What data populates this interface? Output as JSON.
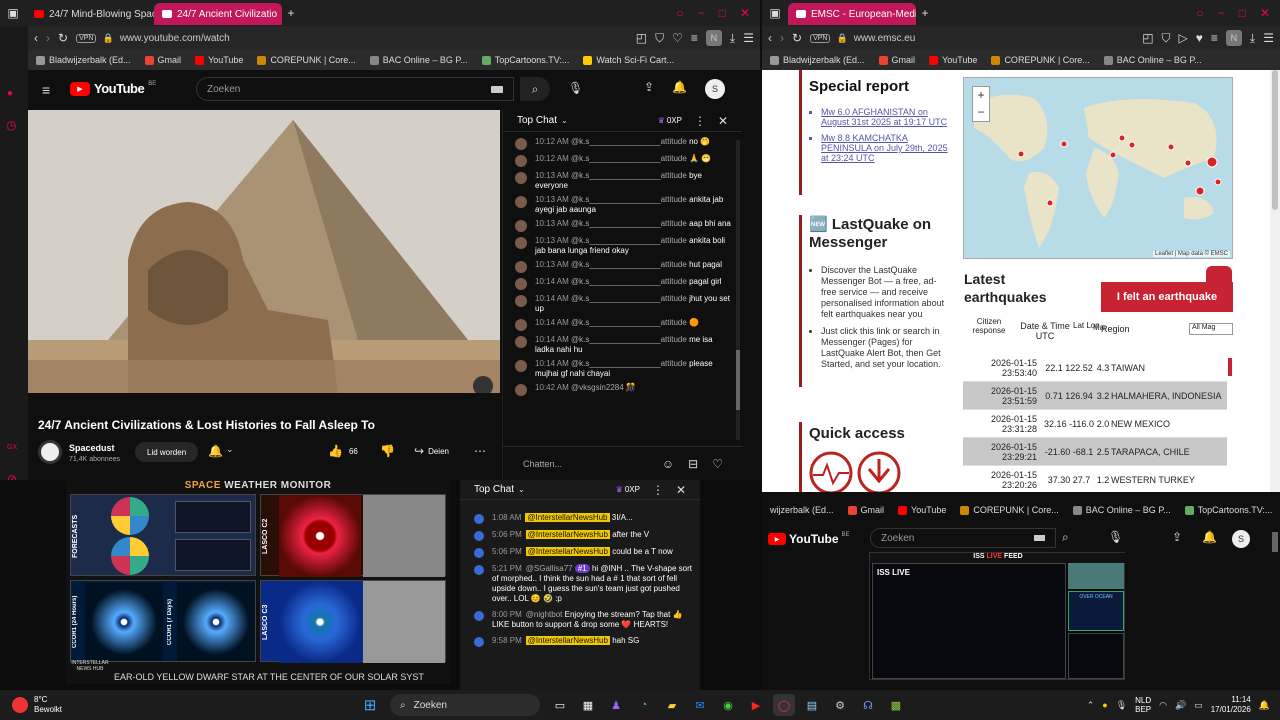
{
  "left_browser": {
    "tabs": [
      {
        "label": "24/7 Mind-Blowing Space"
      },
      {
        "label": "24/7 Ancient Civilizatio"
      }
    ],
    "url": "www.youtube.com/watch",
    "vpn": "VPN",
    "bookmarks": [
      "Bladwijzerbalk (Ed...",
      "Gmail",
      "YouTube",
      "COREPUNK | Core...",
      "BAC Online – BG P...",
      "TopCartoons.TV:...",
      "Watch Sci-Fi Cart..."
    ],
    "profile_letter": "N"
  },
  "youtube": {
    "logo": "YouTube",
    "region": "BE",
    "search_placeholder": "Zoeken",
    "avatar_letter": "S",
    "video_title": "24/7 Ancient Civilizations & Lost Histories to Fall Asleep To",
    "channel": "Spacedust",
    "subscribers": "71,4K abonnees",
    "join": "Lid worden",
    "likes": "66",
    "share": "Deien",
    "chat": {
      "title": "Top Chat",
      "points": "0XP",
      "input_placeholder": "Chatten...",
      "messages": [
        {
          "time": "10:12 AM",
          "name": "@k.s________________attitude",
          "text": "no 🤭"
        },
        {
          "time": "10:12 AM",
          "name": "@k.s________________attitude",
          "text": "🙏 😁"
        },
        {
          "time": "10:13 AM",
          "name": "@k.s________________attitude",
          "text": "bye everyone"
        },
        {
          "time": "10:13 AM",
          "name": "@k.s________________attitude",
          "text": "ankita jab ayegi jab aaunga"
        },
        {
          "time": "10:13 AM",
          "name": "@k.s________________attitude",
          "text": "aap bhi ana"
        },
        {
          "time": "10:13 AM",
          "name": "@k.s________________attitude",
          "text": "ankita boli jab bana lunga friend okay"
        },
        {
          "time": "10:13 AM",
          "name": "@k.s________________attitude",
          "text": "hut pagal"
        },
        {
          "time": "10:14 AM",
          "name": "@k.s________________attitude",
          "text": "pagal girl"
        },
        {
          "time": "10:14 AM",
          "name": "@k.s________________attitude",
          "text": "jhut you set up"
        },
        {
          "time": "10:14 AM",
          "name": "@k.s________________attitude",
          "text": "🟠"
        },
        {
          "time": "10:14 AM",
          "name": "@k.s________________attitude",
          "text": "me isa ladka nahi hu"
        },
        {
          "time": "10:14 AM",
          "name": "@k.s________________attitude",
          "text": "please mujhai gf nahi chayai"
        },
        {
          "time": "10:42 AM",
          "name": "@vksgsin2284",
          "text": "🎊"
        }
      ]
    }
  },
  "space_weather": {
    "title_a": "SPACE",
    "title_b": "WEATHER MONITOR",
    "panel_labels": [
      "FORECASTS",
      "LASCO C2",
      "CCOR1 (24 Hours)",
      "CCOR1 (7 Days)",
      "LASCO C3"
    ],
    "ticker": "EAR-OLD YELLOW DWARF STAR AT THE CENTER OF OUR SOLAR SYST",
    "brand": "INTERSTELLAR NEWS HUB"
  },
  "bottom_chat": {
    "title": "Top Chat",
    "points": "0XP",
    "messages": [
      {
        "time": "1:08 AM",
        "name": "@InterstellarNewsHub",
        "text": "3I/A..."
      },
      {
        "time": "5:06 PM",
        "name": "@InterstellarNewsHub",
        "text": "after the V"
      },
      {
        "time": "5:06 PM",
        "name": "@InterstellarNewsHub",
        "text": "could be a T now"
      },
      {
        "time": "5:21 PM",
        "name": "@SGallisa77",
        "badge": "#1",
        "text": "hi @INH .. The V-shape sort of morphed.. I think the sun had a # 1 that sort of fell upside down.. I guess the sun's team just got pushed over.. LOL 😊 🤣 :p"
      },
      {
        "time": "8:00 PM",
        "name": "@nightbot",
        "text": "Enjoying the stream? Tap that 👍 LIKE button to support & drop some ❤️ HEARTS!"
      },
      {
        "time": "9:58 PM",
        "name": "@InterstellarNewsHub",
        "text": "hah SG"
      }
    ]
  },
  "right_browser": {
    "tabs": [
      {
        "label": "EMSC - European-Mediter"
      }
    ],
    "url": "www.emsc.eu",
    "vpn": "VPN",
    "bookmarks": [
      "Bladwijzerbalk (Ed...",
      "Gmail",
      "YouTube",
      "COREPUNK | Core...",
      "BAC Online – BG P..."
    ],
    "profile_letter": "N"
  },
  "emsc": {
    "special_report": "Special report",
    "report_links": [
      "Mw 6.0 AFGHANISTAN on August 31st 2025 at 19:17 UTC",
      "Mw 8.8 KAMCHATKA PENINSULA on July 29th, 2025 at 23:24 UTC"
    ],
    "lastquake_title": "🆕 LastQuake on Messenger",
    "lastquake_p1": "Discover the LastQuake Messenger Bot — a free, ad-free service — and receive personalised information about felt earthquakes near you",
    "lastquake_p2": "Just click this link or search in Messenger (Pages) for LastQuake Alert Bot, then Get Started, and set your location.",
    "quick_access": "Quick access",
    "map_attribution": "Leaflet | Map data © EMSC",
    "latest_title": "Latest earthquakes",
    "felt_button": "I felt an earthquake",
    "table_headers": [
      "Citizen response",
      "Date & Time UTC",
      "Lat Lon",
      "Mag",
      "Region"
    ],
    "mag_filter": "All Mag",
    "quakes": [
      {
        "date": "2026-01-15",
        "time": "23:53:40",
        "lat": "22.1",
        "lon": "122.52",
        "mag": "4.3",
        "region": "TAIWAN"
      },
      {
        "date": "2026-01-15",
        "time": "23:51:59",
        "lat": "0.71",
        "lon": "126.94",
        "mag": "3.2",
        "region": "HALMAHERA, INDONESIA"
      },
      {
        "date": "2026-01-15",
        "time": "23:31:28",
        "lat": "32.16",
        "lon": "-116.0",
        "mag": "2.0",
        "region": "NEW MEXICO"
      },
      {
        "date": "2026-01-15",
        "time": "23:29:21",
        "lat": "-21.60",
        "lon": "-68.1",
        "mag": "2.5",
        "region": "TARAPACA, CHILE"
      },
      {
        "date": "2026-01-15",
        "time": "23:20:26",
        "lat": "37.30",
        "lon": "27.7",
        "mag": "1.2",
        "region": "WESTERN TURKEY"
      }
    ]
  },
  "bottom_right": {
    "bookmarks": [
      "wijzerbalk (Ed...",
      "Gmail",
      "YouTube",
      "COREPUNK | Core...",
      "BAC Online – BG P...",
      "TopCartoons.TV:..."
    ],
    "logo": "YouTube",
    "region": "BE",
    "search_placeholder": "Zoeken",
    "avatar_letter": "S",
    "iss_feed_a": "ISS",
    "iss_feed_live": "LIVE",
    "iss_feed_b": "FEED",
    "iss_live": "ISS LIVE",
    "over_ocean": "OVER OCEAN"
  },
  "taskbar": {
    "temp": "8°C",
    "weather": "Bewolkt",
    "search": "Zoeken",
    "lang_a": "NLD",
    "lang_b": "BEP",
    "time": "11:14",
    "date": "17/01/2026"
  }
}
